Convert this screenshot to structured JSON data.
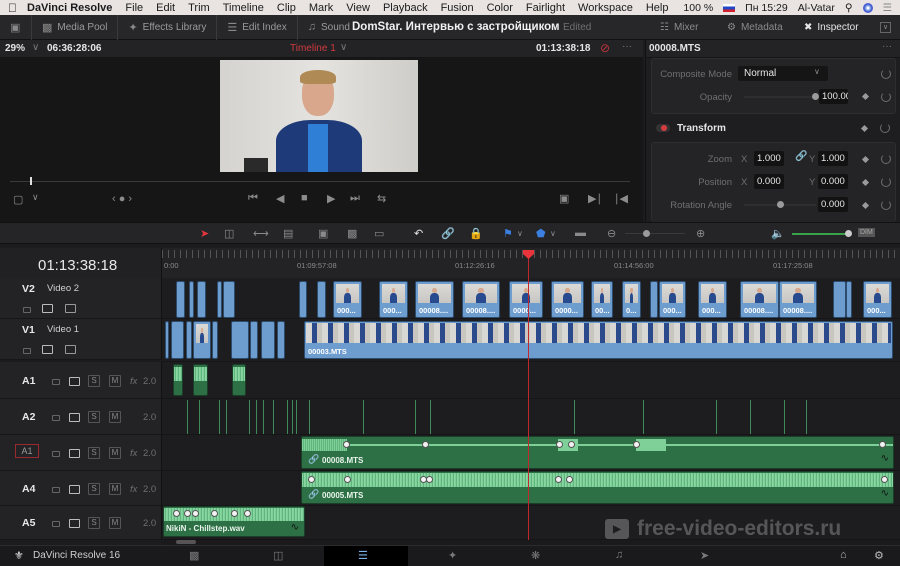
{
  "menubar": {
    "app": "DaVinci Resolve",
    "items": [
      "File",
      "Edit",
      "Trim",
      "Timeline",
      "Clip",
      "Mark",
      "View",
      "Playback",
      "Fusion",
      "Color",
      "Fairlight",
      "Workspace",
      "Help"
    ],
    "battery": "100 %",
    "clock": "Пн 15:29",
    "user": "Al-Vatar"
  },
  "toolbar": {
    "media_pool": "Media Pool",
    "effects_library": "Effects Library",
    "edit_index": "Edit Index",
    "sound_library": "Sound",
    "project_title": "DomStar. Интервью с застройщиком",
    "project_status": "Edited",
    "mixer": "Mixer",
    "metadata": "Metadata",
    "inspector": "Inspector"
  },
  "viewer": {
    "zoom": "29%",
    "source_timecode": "06:36:28:06",
    "timeline_name": "Timeline 1",
    "record_timecode": "01:13:38:18",
    "scrub_position": 0.035
  },
  "inspector": {
    "clip_name": "00008.MTS",
    "composite_mode_label": "Composite Mode",
    "composite_mode_value": "Normal",
    "opacity_label": "Opacity",
    "opacity_value": "100.00",
    "transform_label": "Transform",
    "zoom_label": "Zoom",
    "zoom_x": "1.000",
    "zoom_y": "1.000",
    "position_label": "Position",
    "position_x": "0.000",
    "position_y": "0.000",
    "rotation_label": "Rotation Angle",
    "rotation_value": "0.000",
    "axis_x": "X",
    "axis_y": "Y"
  },
  "timeline": {
    "timecode": "01:13:38:18",
    "ruler_labels": [
      "0:00",
      "01:09:57:08",
      "01:12:26:16",
      "01:14:56:00",
      "01:17:25:08"
    ],
    "dim_label": "DIM",
    "video_tracks": [
      {
        "id": "V2",
        "name": "Video 2"
      },
      {
        "id": "V1",
        "name": "Video 1"
      }
    ],
    "audio_tracks": [
      {
        "id": "A1",
        "level": "2.0",
        "fx": "fx"
      },
      {
        "id": "A2",
        "level": "2.0",
        "fx": ""
      },
      {
        "id": "A1",
        "level": "2.0",
        "fx": "fx"
      },
      {
        "id": "A4",
        "level": "2.0",
        "fx": "fx"
      },
      {
        "id": "A5",
        "level": "2.0",
        "fx": ""
      }
    ],
    "solo_label": "S",
    "mute_label": "M",
    "v2_clip_labels": [
      "000...",
      "000...",
      "00008....",
      "00008....",
      "0000...",
      "0000...",
      "00...",
      "0...",
      "000...",
      "000...",
      "00008....",
      "00008....",
      "000..."
    ],
    "v1_clip_label": "00003.MTS",
    "a3_clip_label": "00008.MTS",
    "a4_clip_label": "00005.MTS",
    "a5_clip_label": "NikiN - Chillstep.wav"
  },
  "pagebar": {
    "app_name": "DaVinci Resolve 16"
  },
  "watermark": "free-video-editors.ru"
}
